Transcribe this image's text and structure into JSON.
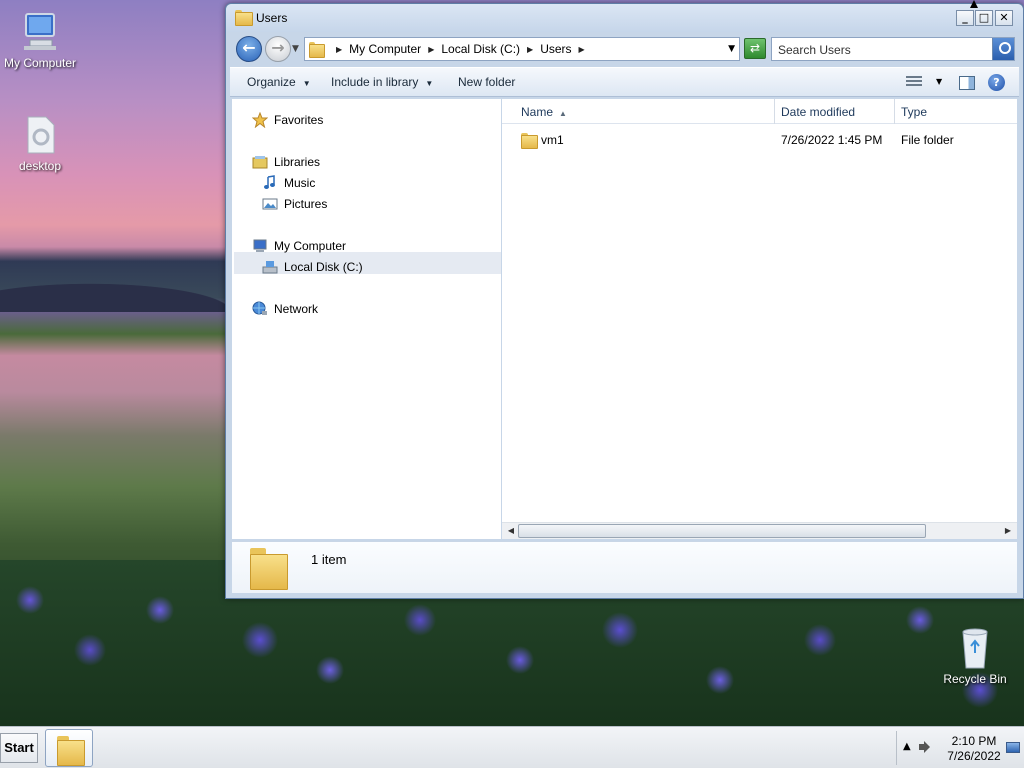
{
  "desktop": {
    "icons": [
      {
        "label": "My Computer"
      },
      {
        "label": "desktop"
      },
      {
        "label": "Recycle Bin"
      }
    ]
  },
  "window": {
    "title": "Users",
    "controls": {
      "minimize": "_",
      "maximize": "□",
      "close": "✕"
    },
    "address": {
      "crumbs": [
        "My Computer",
        "Local Disk (C:)",
        "Users"
      ]
    },
    "search": {
      "placeholder": "Search Users"
    },
    "toolbar": {
      "organize": "Organize",
      "include_in_library": "Include in library",
      "new_folder": "New folder",
      "help": "?"
    },
    "nav": {
      "favorites": "Favorites",
      "libraries": "Libraries",
      "music": "Music",
      "pictures": "Pictures",
      "my_computer": "My Computer",
      "local_disk": "Local Disk (C:)",
      "network": "Network"
    },
    "columns": {
      "name": "Name",
      "date_modified": "Date modified",
      "type": "Type"
    },
    "files": [
      {
        "name": "vm1",
        "date_modified": "7/26/2022 1:45 PM",
        "type": "File folder"
      }
    ],
    "details": {
      "count": "1 item"
    }
  },
  "taskbar": {
    "start": "Start",
    "clock": {
      "time": "2:10 PM",
      "date": "7/26/2022"
    }
  },
  "colors": {
    "accent": "#2a63b8",
    "selection": "#e5eaf2",
    "folder": "#f0cf6a"
  }
}
